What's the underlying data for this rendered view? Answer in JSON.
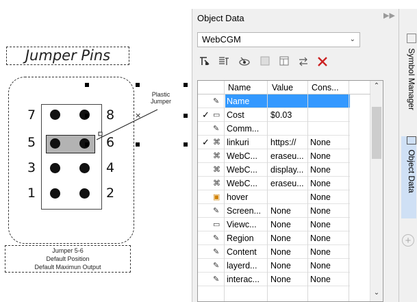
{
  "canvas": {
    "title": "Jumper Pins",
    "plastic_label": "Plastic\nJumper",
    "caption_line1": "Jumper 5-6",
    "caption_line2": "Default Position",
    "caption_line3": "Default Maximun Output",
    "pin_numbers": [
      "7",
      "8",
      "5",
      "6",
      "3",
      "4",
      "1",
      "2"
    ]
  },
  "panel": {
    "title": "Object Data",
    "dropdown_value": "WebCGM",
    "toolbar_icons": [
      "field-editor-icon",
      "format-data-icon",
      "show-icon",
      "grid-icon",
      "table-icon",
      "swap-icon",
      "delete-icon"
    ],
    "columns": [
      "Name",
      "Value",
      "Cons..."
    ],
    "rows": [
      {
        "check": "",
        "icon": "field-icon",
        "name": "Name",
        "value": "",
        "cons": "",
        "selected": true
      },
      {
        "check": "✓",
        "icon": "db-icon",
        "name": "Cost",
        "value": "$0.03",
        "cons": "",
        "selected": false
      },
      {
        "check": "",
        "icon": "field-icon",
        "name": "Comm...",
        "value": "",
        "cons": "",
        "selected": false
      },
      {
        "check": "✓",
        "icon": "link-icon",
        "name": "linkuri",
        "value": "https://",
        "cons": "None",
        "selected": false
      },
      {
        "check": "",
        "icon": "link-icon",
        "name": "WebC...",
        "value": "eraseu...",
        "cons": "None",
        "selected": false
      },
      {
        "check": "",
        "icon": "link-icon",
        "name": "WebC...",
        "value": "display...",
        "cons": "None",
        "selected": false
      },
      {
        "check": "",
        "icon": "link-icon",
        "name": "WebC...",
        "value": "eraseu...",
        "cons": "None",
        "selected": false
      },
      {
        "check": "",
        "icon": "hover-icon",
        "name": "hover",
        "value": "",
        "cons": "None",
        "selected": false
      },
      {
        "check": "",
        "icon": "field-icon",
        "name": "Screen...",
        "value": "None",
        "cons": "None",
        "selected": false
      },
      {
        "check": "",
        "icon": "db-icon",
        "name": "Viewc...",
        "value": "None",
        "cons": "None",
        "selected": false
      },
      {
        "check": "",
        "icon": "field-icon",
        "name": "Region",
        "value": "None",
        "cons": "None",
        "selected": false
      },
      {
        "check": "",
        "icon": "field-icon",
        "name": "Content",
        "value": "None",
        "cons": "None",
        "selected": false
      },
      {
        "check": "",
        "icon": "field-icon",
        "name": "layerd...",
        "value": "None",
        "cons": "None",
        "selected": false
      },
      {
        "check": "",
        "icon": "field-icon",
        "name": "interac...",
        "value": "None",
        "cons": "None",
        "selected": false
      }
    ]
  },
  "dock": {
    "tab1": "Symbol Manager",
    "tab2": "Object Data"
  },
  "colors": {
    "selection": "#3399ff",
    "panel_bg": "#f0f0f0",
    "active_tab": "#cfe0f5"
  }
}
